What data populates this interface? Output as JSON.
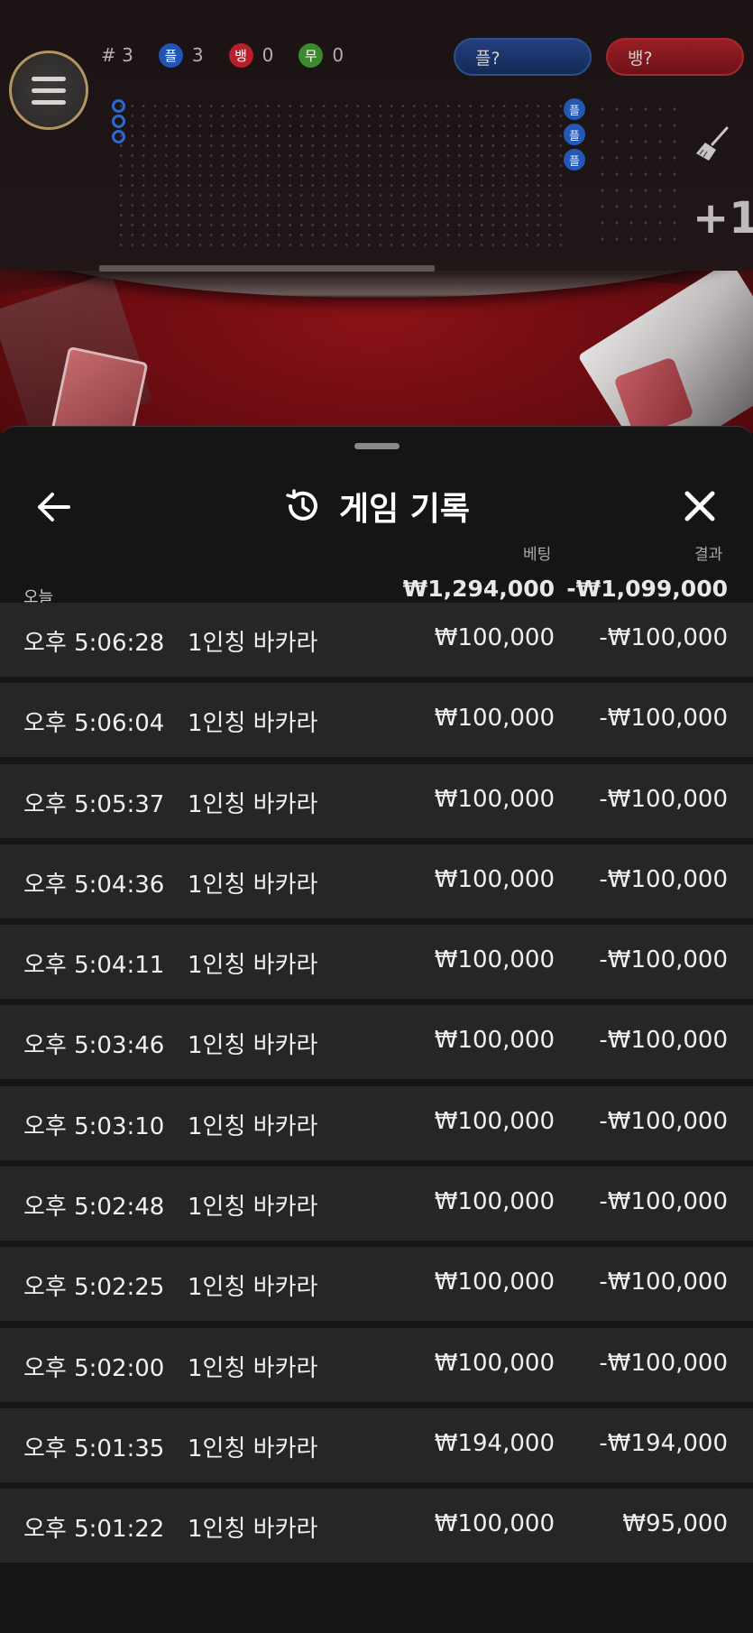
{
  "game": {
    "stats": {
      "round_label": "# 3",
      "player_icon": "플",
      "player_count": "3",
      "banker_icon": "뱅",
      "banker_count": "0",
      "tie_icon": "무",
      "tie_count": "0"
    },
    "predict_player": "플?",
    "predict_banker": "뱅?",
    "road_chip": "플",
    "plus_one": "+1",
    "colors": {
      "player": "#1f56b6",
      "banker": "#b5202c",
      "tie": "#3c8a2e"
    }
  },
  "sheet": {
    "title": "게임 기록",
    "icons": {
      "back": "arrow-left-icon",
      "history": "history-icon",
      "close": "close-icon"
    },
    "columns": {
      "bet": "베팅",
      "result": "결과"
    },
    "summary": {
      "label": "오늘",
      "bet": "₩1,294,000",
      "result": "-₩1,099,000"
    },
    "rows": [
      {
        "time": "오후 5:06:28",
        "game": "1인칭 바카라",
        "bet": "₩100,000",
        "result": "-₩100,000"
      },
      {
        "time": "오후 5:06:04",
        "game": "1인칭 바카라",
        "bet": "₩100,000",
        "result": "-₩100,000"
      },
      {
        "time": "오후 5:05:37",
        "game": "1인칭 바카라",
        "bet": "₩100,000",
        "result": "-₩100,000"
      },
      {
        "time": "오후 5:04:36",
        "game": "1인칭 바카라",
        "bet": "₩100,000",
        "result": "-₩100,000"
      },
      {
        "time": "오후 5:04:11",
        "game": "1인칭 바카라",
        "bet": "₩100,000",
        "result": "-₩100,000"
      },
      {
        "time": "오후 5:03:46",
        "game": "1인칭 바카라",
        "bet": "₩100,000",
        "result": "-₩100,000"
      },
      {
        "time": "오후 5:03:10",
        "game": "1인칭 바카라",
        "bet": "₩100,000",
        "result": "-₩100,000"
      },
      {
        "time": "오후 5:02:48",
        "game": "1인칭 바카라",
        "bet": "₩100,000",
        "result": "-₩100,000"
      },
      {
        "time": "오후 5:02:25",
        "game": "1인칭 바카라",
        "bet": "₩100,000",
        "result": "-₩100,000"
      },
      {
        "time": "오후 5:02:00",
        "game": "1인칭 바카라",
        "bet": "₩100,000",
        "result": "-₩100,000"
      },
      {
        "time": "오후 5:01:35",
        "game": "1인칭 바카라",
        "bet": "₩194,000",
        "result": "-₩194,000"
      },
      {
        "time": "오후 5:01:22",
        "game": "1인칭 바카라",
        "bet": "₩100,000",
        "result": "₩95,000"
      }
    ]
  }
}
